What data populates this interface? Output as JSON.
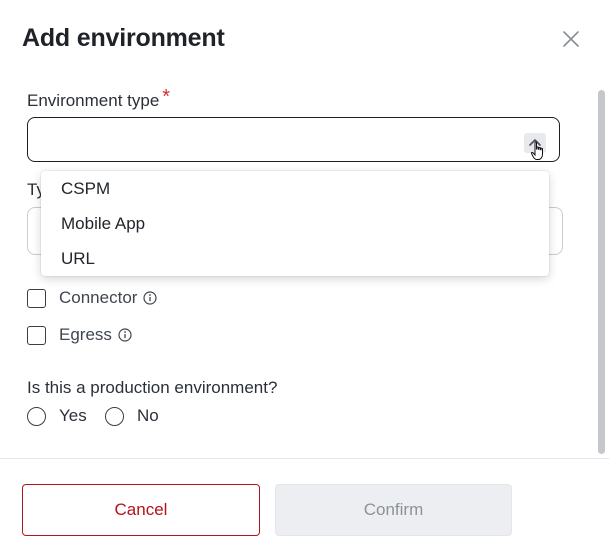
{
  "dialog": {
    "title": "Add environment"
  },
  "environment_type": {
    "label": "Environment type",
    "required_mark": "*",
    "value": "",
    "options": [
      "CSPM",
      "Mobile App",
      "URL"
    ]
  },
  "type_field": {
    "label_partial": "Ty"
  },
  "checkboxes": [
    {
      "label": "Connector",
      "checked": false
    },
    {
      "label": "Egress",
      "checked": false
    }
  ],
  "production": {
    "question": "Is this a production environment?",
    "options": [
      "Yes",
      "No"
    ]
  },
  "footer": {
    "cancel_label": "Cancel",
    "confirm_label": "Confirm"
  },
  "colors": {
    "danger": "#b5121b",
    "required": "#d0302a",
    "disabled_bg": "#eceef1",
    "disabled_text": "#8c929a"
  }
}
